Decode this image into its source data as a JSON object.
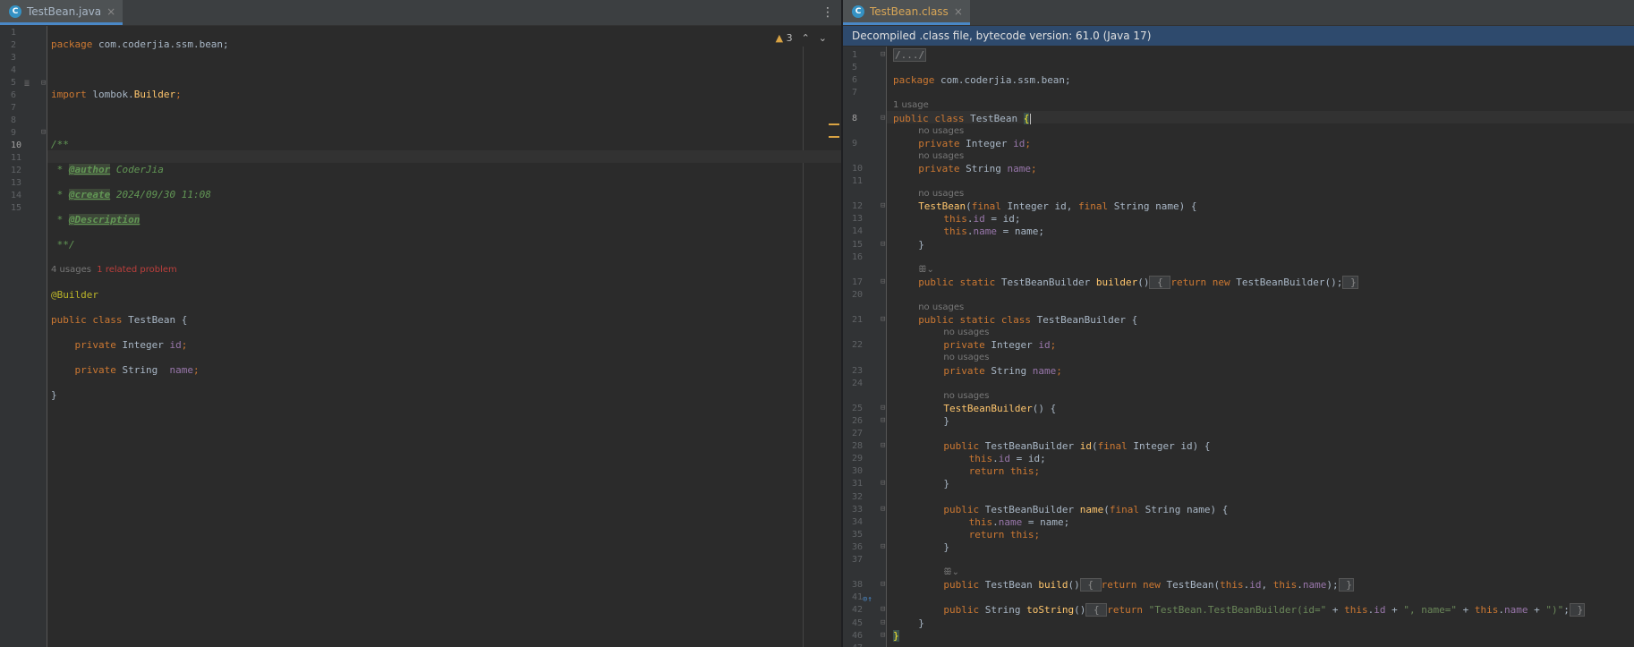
{
  "left": {
    "tab": {
      "label": "TestBean.java",
      "icon": "class-icon",
      "close": "×"
    },
    "warnings": {
      "count": "3",
      "icon": "warning-icon"
    },
    "line_numbers": [
      "1",
      "2",
      "3",
      "4",
      "5",
      "6",
      "7",
      "8",
      "9",
      "10",
      "11",
      "12",
      "13",
      "14",
      "15"
    ],
    "current_line": "10",
    "hints": {
      "usages": "4 usages",
      "problem": "1 related problem"
    },
    "code": {
      "l1_kw": "package",
      "l1_rest": " com.coderjia.ssm.bean;",
      "l3_kw": "import",
      "l3_rest": " lombok.",
      "l3_cls": "Builder",
      "l3_end": ";",
      "l5": "/**",
      "l6_pre": " * ",
      "l6_tag": "@author",
      "l6_val": " CoderJia",
      "l7_pre": " * ",
      "l7_tag": "@create",
      "l7_val": " 2024/09/30 11:08",
      "l8_pre": " * ",
      "l8_tag": "@Description",
      "l9": " **/",
      "l10": "@Builder",
      "l11_kw": "public class",
      "l11_rest": " TestBean {",
      "l12_kw": "    private",
      "l12_type": " Integer ",
      "l12_fld": "id",
      "l12_end": ";",
      "l13_kw": "    private",
      "l13_type": " String  ",
      "l13_fld": "name",
      "l13_end": ";",
      "l14": "}"
    }
  },
  "right": {
    "tab": {
      "label": "TestBean.class",
      "icon": "class-icon",
      "close": "×"
    },
    "banner": "Decompiled .class file, bytecode version: 61.0 (Java 17)",
    "line_numbers": [
      "1",
      "5",
      "6",
      "7",
      "8",
      "9",
      "10",
      "11",
      "12",
      "13",
      "14",
      "15",
      "16",
      "17",
      "20",
      "21",
      "22",
      "23",
      "24",
      "25",
      "26",
      "27",
      "28",
      "29",
      "30",
      "31",
      "32",
      "33",
      "34",
      "35",
      "36",
      "37",
      "38",
      "41",
      "42",
      "45",
      "46",
      "47"
    ],
    "current_line": "8",
    "hints": {
      "one_usage": "1 usage",
      "no_usages": "no usages",
      "lombok_marker": "ꕥ⌄"
    },
    "code": {
      "r1": "/.../",
      "r6_kw": "package",
      "r6_rest": " com.coderjia.ssm.bean;",
      "r8_kw": "public class",
      "r8_rest": " TestBean ",
      "r8_brace": "{",
      "r9_kw": "private",
      "r9_type": " Integer ",
      "r9_fld": "id",
      "r9_end": ";",
      "r10_kw": "private",
      "r10_type": " String ",
      "r10_fld": "name",
      "r10_end": ";",
      "r12_fn": "TestBean",
      "r12_a": "(",
      "r12_k1": "final",
      "r12_b": " Integer id, ",
      "r12_k2": "final",
      "r12_c": " String name) {",
      "r13_kw": "this",
      "r13_a": ".",
      "r13_fld": "id",
      "r13_b": " = id;",
      "r14_kw": "this",
      "r14_a": ".",
      "r14_fld": "name",
      "r14_b": " = name;",
      "r15": "}",
      "r17_kw": "public static",
      "r17_a": " TestBeanBuilder ",
      "r17_fn": "builder",
      "r17_b": "()",
      "r17_fo": " { ",
      "r17_kw2": "return new",
      "r17_c": " TestBeanBuilder();",
      "r17_fc": " }",
      "r21_kw": "public static class",
      "r21_rest": " TestBeanBuilder {",
      "r22_kw": "private",
      "r22_type": " Integer ",
      "r22_fld": "id",
      "r22_end": ";",
      "r23_kw": "private",
      "r23_type": " String ",
      "r23_fld": "name",
      "r23_end": ";",
      "r25_fn": "TestBeanBuilder",
      "r25_rest": "() {",
      "r26": "}",
      "r28_kw": "public",
      "r28_a": " TestBeanBuilder ",
      "r28_fn": "id",
      "r28_b": "(",
      "r28_k": "final",
      "r28_c": " Integer id) {",
      "r29_kw": "this",
      "r29_a": ".",
      "r29_fld": "id",
      "r29_b": " = id;",
      "r30_kw": "return this",
      "r30_b": ";",
      "r31": "}",
      "r33_kw": "public",
      "r33_a": " TestBeanBuilder ",
      "r33_fn": "name",
      "r33_b": "(",
      "r33_k": "final",
      "r33_c": " String name) {",
      "r34_kw": "this",
      "r34_a": ".",
      "r34_fld": "name",
      "r34_b": " = name;",
      "r35_kw": "return this",
      "r35_b": ";",
      "r36": "}",
      "r38_kw": "public",
      "r38_a": " TestBean ",
      "r38_fn": "build",
      "r38_b": "()",
      "r38_fo": " { ",
      "r38_kw2": "return new",
      "r38_c": " TestBean(",
      "r38_t1": "this",
      "r38_d": ".",
      "r38_f1": "id",
      "r38_e": ", ",
      "r38_t2": "this",
      "r38_g": ".",
      "r38_f2": "name",
      "r38_h": ");",
      "r38_fc": " }",
      "r42_kw": "public",
      "r42_a": " String ",
      "r42_fn": "toString",
      "r42_b": "()",
      "r42_fo": " { ",
      "r42_kw2": "return",
      "r42_s1": " \"TestBean.TestBeanBuilder(id=\"",
      "r42_c": " + ",
      "r42_t1": "this",
      "r42_d": ".",
      "r42_f1": "id",
      "r42_e": " + ",
      "r42_s2": "\", name=\"",
      "r42_g": " + ",
      "r42_t2": "this",
      "r42_h": ".",
      "r42_f2": "name",
      "r42_i": " + ",
      "r42_s3": "\")\"",
      "r42_j": ";",
      "r42_fc": " }",
      "r45": "}",
      "r46": "}"
    }
  },
  "colors": {
    "keyword": "#cc7832",
    "field": "#9876aa",
    "method": "#ffc66d",
    "string": "#6a8759",
    "annotation": "#bbb529",
    "banner": "#2e4a6d"
  }
}
